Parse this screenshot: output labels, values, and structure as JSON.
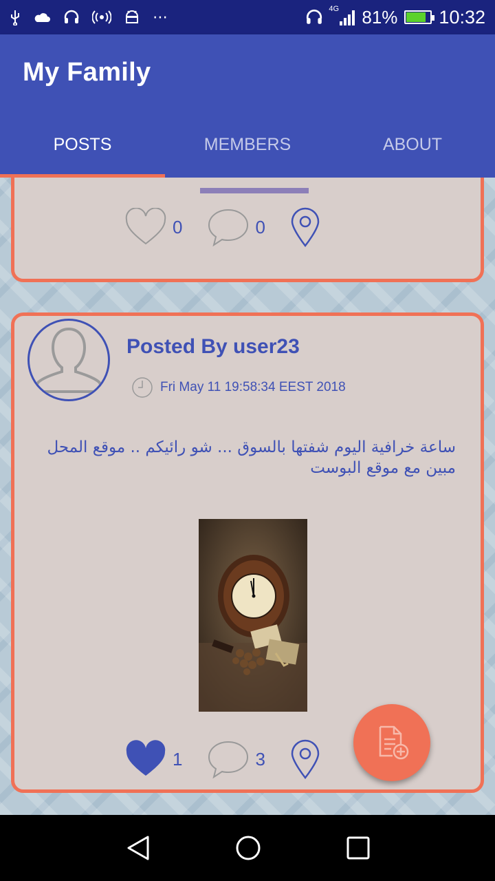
{
  "status_bar": {
    "icons": [
      "usb-icon",
      "cloud-icon",
      "headset-icon",
      "hotspot-icon",
      "android-icon",
      "more-icon"
    ],
    "network": "4G",
    "battery_percent": "81%",
    "battery_level": 0.81,
    "time": "10:32"
  },
  "app_bar": {
    "title": "My Family"
  },
  "tabs": [
    {
      "label": "POSTS",
      "active": true
    },
    {
      "label": "MEMBERS",
      "active": false
    },
    {
      "label": "ABOUT",
      "active": false
    }
  ],
  "posts": [
    {
      "likes": "0",
      "comments": "0",
      "liked": false
    },
    {
      "posted_by": "Posted By user23",
      "date": "Fri May 11 19:58:34 EEST 2018",
      "text": "ساعة خرافية اليوم شفتها بالسوق ... شو رائيكم .. موقع المحل مبين مع موقع البوست",
      "likes": "1",
      "comments": "3",
      "liked": true
    }
  ],
  "colors": {
    "primary": "#3f51b5",
    "primary_dark": "#1a237e",
    "accent": "#f07156",
    "card_bg": "#d8cecb"
  }
}
